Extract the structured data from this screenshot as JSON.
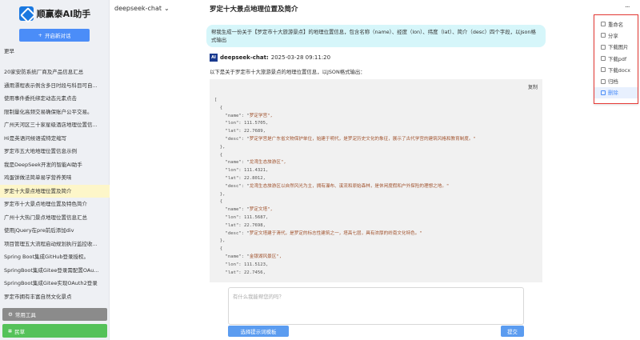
{
  "sidebar": {
    "logo_text": "顺赢泰AI助手",
    "new_chat_label": "开启新对话",
    "section_label": "更早",
    "history": [
      "20家安防系统厂商及产品信息汇总",
      "通用漂程表示例含多日时段与科目可自...",
      "使用事件委托绑定动态元素点击",
      "限制量化高频交易确保账户公平交易。",
      "广州天河区三十家星级酒店地理位置信...",
      "Hi是英语问候语或特定缩写",
      "罗定市五大地地理位置信息示例",
      "我是DeepSeek开发的智能AI助手",
      "鸡蛋饼做法简单易学营养美味",
      "罗定十大景点地理位置及简介",
      "罗定市十大景点地理位置及特色简介",
      "广州十大热门景点地理位置信息汇总",
      "使用jQuery在pre前后添加div",
      "项目管理五大流程启动规划执行监控收...",
      "Spring Boot集成GitHub登录授权。",
      "SpringBoot集成Gitee登录需配置OAu...",
      "SpringBoot集成Gitee实现OAuth2登录",
      "罗定市拥有丰富自然文化景点"
    ],
    "active_index": 9,
    "tools_label": "常用工具",
    "user_label": "民草"
  },
  "header": {
    "model": "deepseek-chat",
    "title": "罗定十大景点地理位置及简介",
    "more_label": "..."
  },
  "chat": {
    "user_message": "帮我生成一份关于【罗定市十大旅游景点】的地理位置信息，包含名称（name）、经度（lon）、纬度（lat）、简介（desc）四个字段，以json格式输出",
    "ai_avatar_text": "AI",
    "ai_name": "deepseek-chat:",
    "ai_time": "2025-03-28 09:11:20",
    "ai_intro": "以下是关于罗定市十大旅游景点的地理位置信息，以JSON格式输出：",
    "copy_label": "复制",
    "code": [
      {
        "name": "罗定学宫",
        "lon": "111.5705",
        "lat": "22.7689",
        "desc": "罗定学宫是广东省文物保护单位，始建于明代，是罗定历史文化的象征，展示了古代学宫的建筑风格和教育制度。"
      },
      {
        "name": "龙湾生态旅游区",
        "lon": "111.4321",
        "lat": "22.8012",
        "desc": "龙湾生态旅游区以自然风光为主，拥有瀑布、溪流和原始森林，是休闲度假和户外探险的理想之地。"
      },
      {
        "name": "罗定文塔",
        "lon": "111.5687",
        "lat": "22.7698",
        "desc": "罗定文塔建于清代，是罗定的标志性建筑之一，塔高七层，具有浓厚的岭南文化特色。"
      },
      {
        "name": "金银湖风景区",
        "lon": "111.5123",
        "lat": "22.7456"
      }
    ]
  },
  "input": {
    "placeholder": "有什么我能帮您的吗？",
    "prompt_template_label": "选择提示词模板",
    "submit_label": "提交"
  },
  "menu": {
    "items": [
      {
        "label": "重命名",
        "icon": "edit-icon"
      },
      {
        "label": "分享",
        "icon": "share-icon"
      },
      {
        "label": "下载图片",
        "icon": "download-icon"
      },
      {
        "label": "下载pdf",
        "icon": "download-icon"
      },
      {
        "label": "下载docx",
        "icon": "download-icon"
      },
      {
        "label": "归档",
        "icon": "archive-icon"
      },
      {
        "label": "删除",
        "icon": "trash-icon"
      }
    ],
    "active_index": 6
  },
  "colors": {
    "primary": "#4b8df8",
    "user_bubble": "#d6f6fa",
    "active_history": "#fdf6c9",
    "tools_button": "#8b8b8b",
    "user_button": "#55c25a",
    "menu_border": "#e53935"
  }
}
